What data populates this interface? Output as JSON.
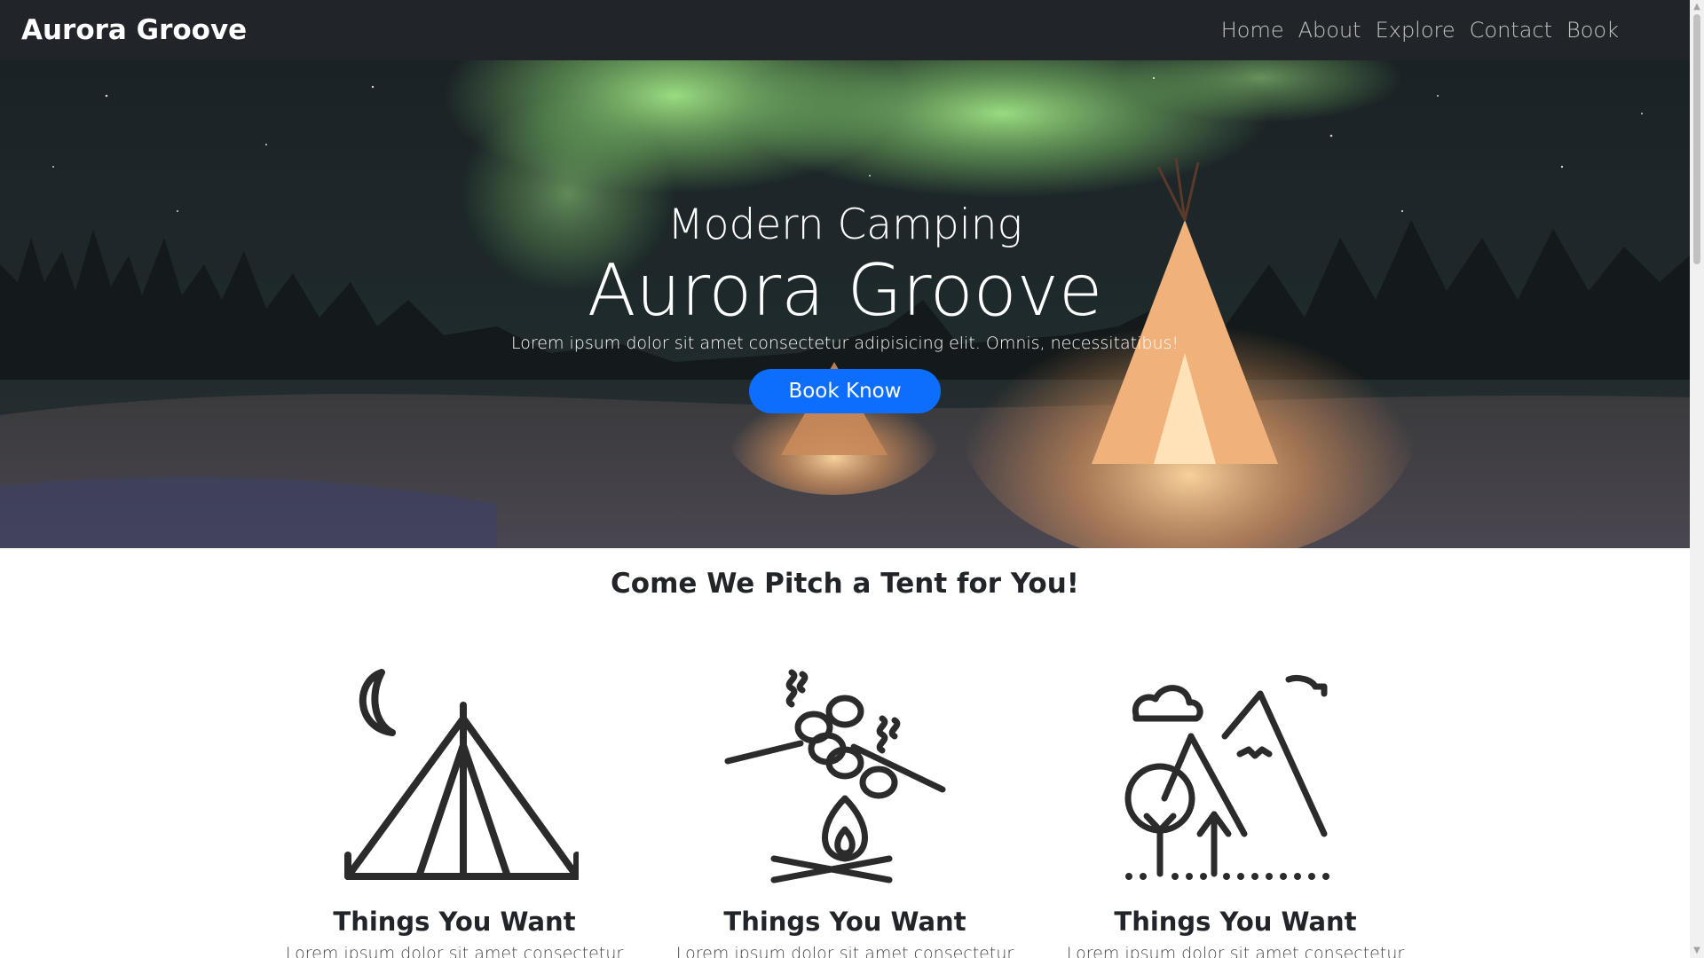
{
  "navbar": {
    "brand": "Aurora Groove",
    "links": [
      "Home",
      "About",
      "Explore",
      "Contact",
      "Book"
    ]
  },
  "hero": {
    "subtitle": "Modern Camping",
    "title": "Aurora Groove",
    "text": "Lorem ipsum dolor sit amet consectetur adipisicing elit. Omnis, necessitatibus!",
    "button": "Book Know"
  },
  "section": {
    "title": "Come We Pitch a Tent for You!",
    "features": [
      {
        "icon": "tent-moon-icon",
        "title": "Things You Want",
        "text": "Lorem ipsum dolor sit amet consectetur"
      },
      {
        "icon": "campfire-marshmallow-icon",
        "title": "Things You Want",
        "text": "Lorem ipsum dolor sit amet consectetur"
      },
      {
        "icon": "mountains-trees-icon",
        "title": "Things You Want",
        "text": "Lorem ipsum dolor sit amet consectetur"
      }
    ]
  },
  "colors": {
    "navbar_bg": "#212529",
    "button_bg": "#0d6efd",
    "aurora": "#9be37a",
    "tent_glow": "#ffb36b"
  }
}
